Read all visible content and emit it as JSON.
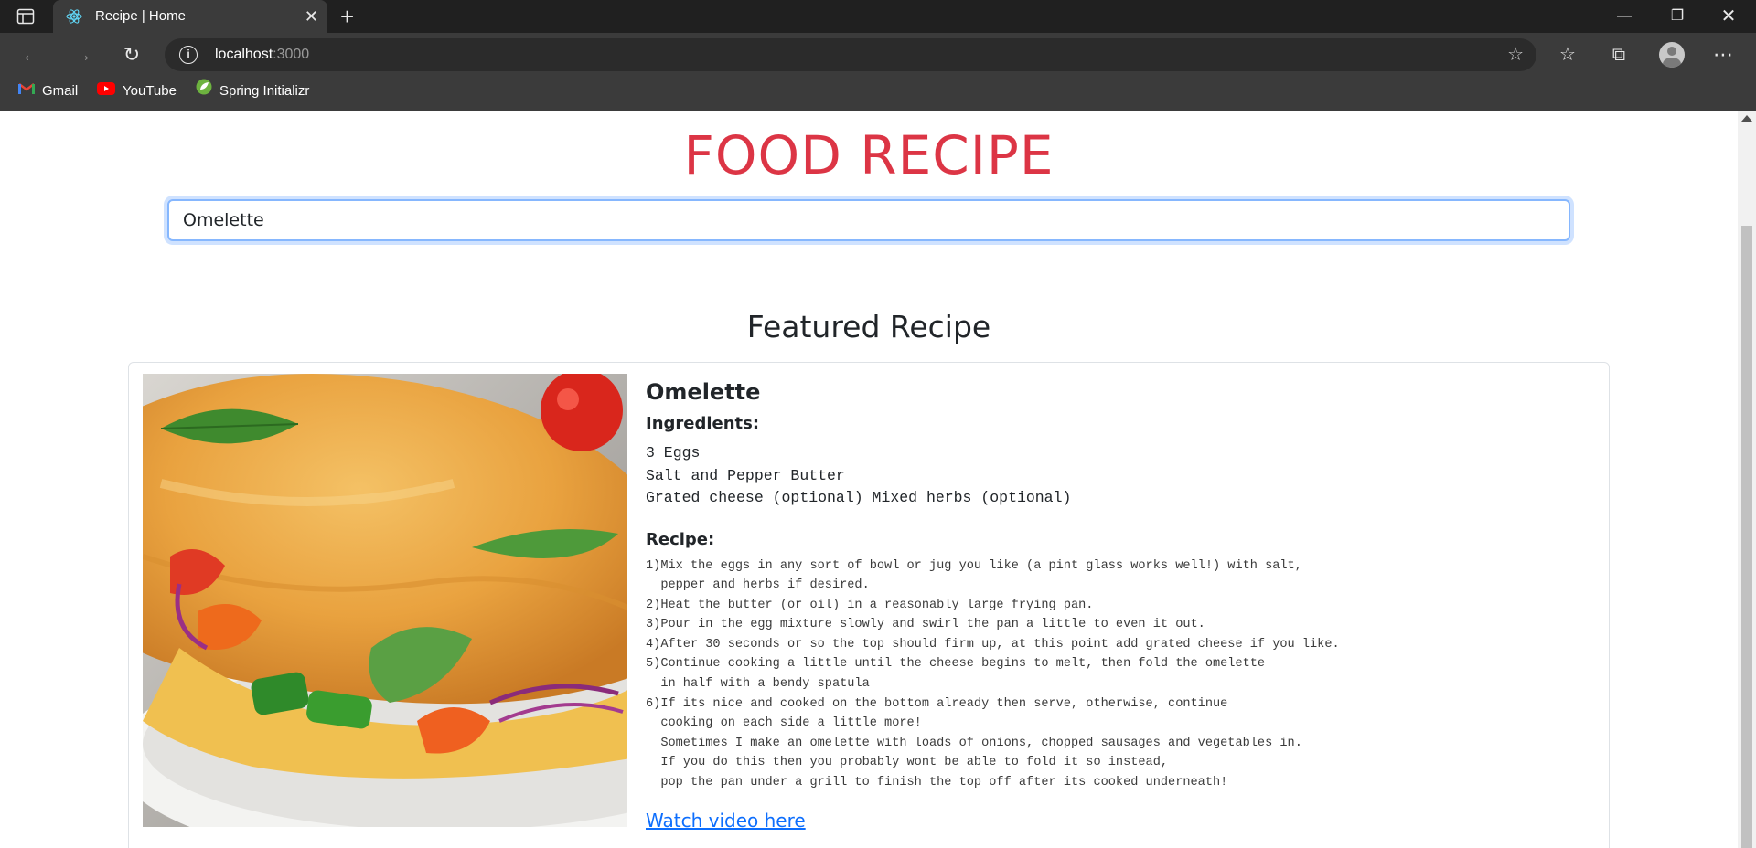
{
  "browser": {
    "tab_title": "Recipe | Home",
    "url_host": "localhost",
    "url_port": ":3000",
    "bookmarks": [
      {
        "label": "Gmail",
        "icon": "gmail-icon"
      },
      {
        "label": "YouTube",
        "icon": "youtube-icon"
      },
      {
        "label": "Spring Initializr",
        "icon": "spring-icon"
      }
    ]
  },
  "page": {
    "title": "FOOD RECIPE",
    "search_value": "Omelette",
    "section_title": "Featured Recipe"
  },
  "recipe": {
    "name": "Omelette",
    "ingredients_label": "Ingredients:",
    "ingredients": "3 Eggs\nSalt and Pepper Butter\nGrated cheese (optional) Mixed herbs (optional)",
    "recipe_label": "Recipe:",
    "steps": "1)Mix the eggs in any sort of bowl or jug you like (a pint glass works well!) with salt,\n  pepper and herbs if desired.\n2)Heat the butter (or oil) in a reasonably large frying pan.\n3)Pour in the egg mixture slowly and swirl the pan a little to even it out.\n4)After 30 seconds or so the top should firm up, at this point add grated cheese if you like.\n5)Continue cooking a little until the cheese begins to melt, then fold the omelette\n  in half with a bendy spatula\n6)If its nice and cooked on the bottom already then serve, otherwise, continue\n  cooking on each side a little more!\n  Sometimes I make an omelette with loads of onions, chopped sausages and vegetables in.\n  If you do this then you probably wont be able to fold it so instead,\n  pop the pan under a grill to finish the top off after its cooked underneath!",
    "video_link": "Watch video here"
  },
  "colors": {
    "title_red": "#dc3545",
    "link_blue": "#0d6efd",
    "chrome_dark": "#202020",
    "chrome_mid": "#3b3b3b"
  }
}
